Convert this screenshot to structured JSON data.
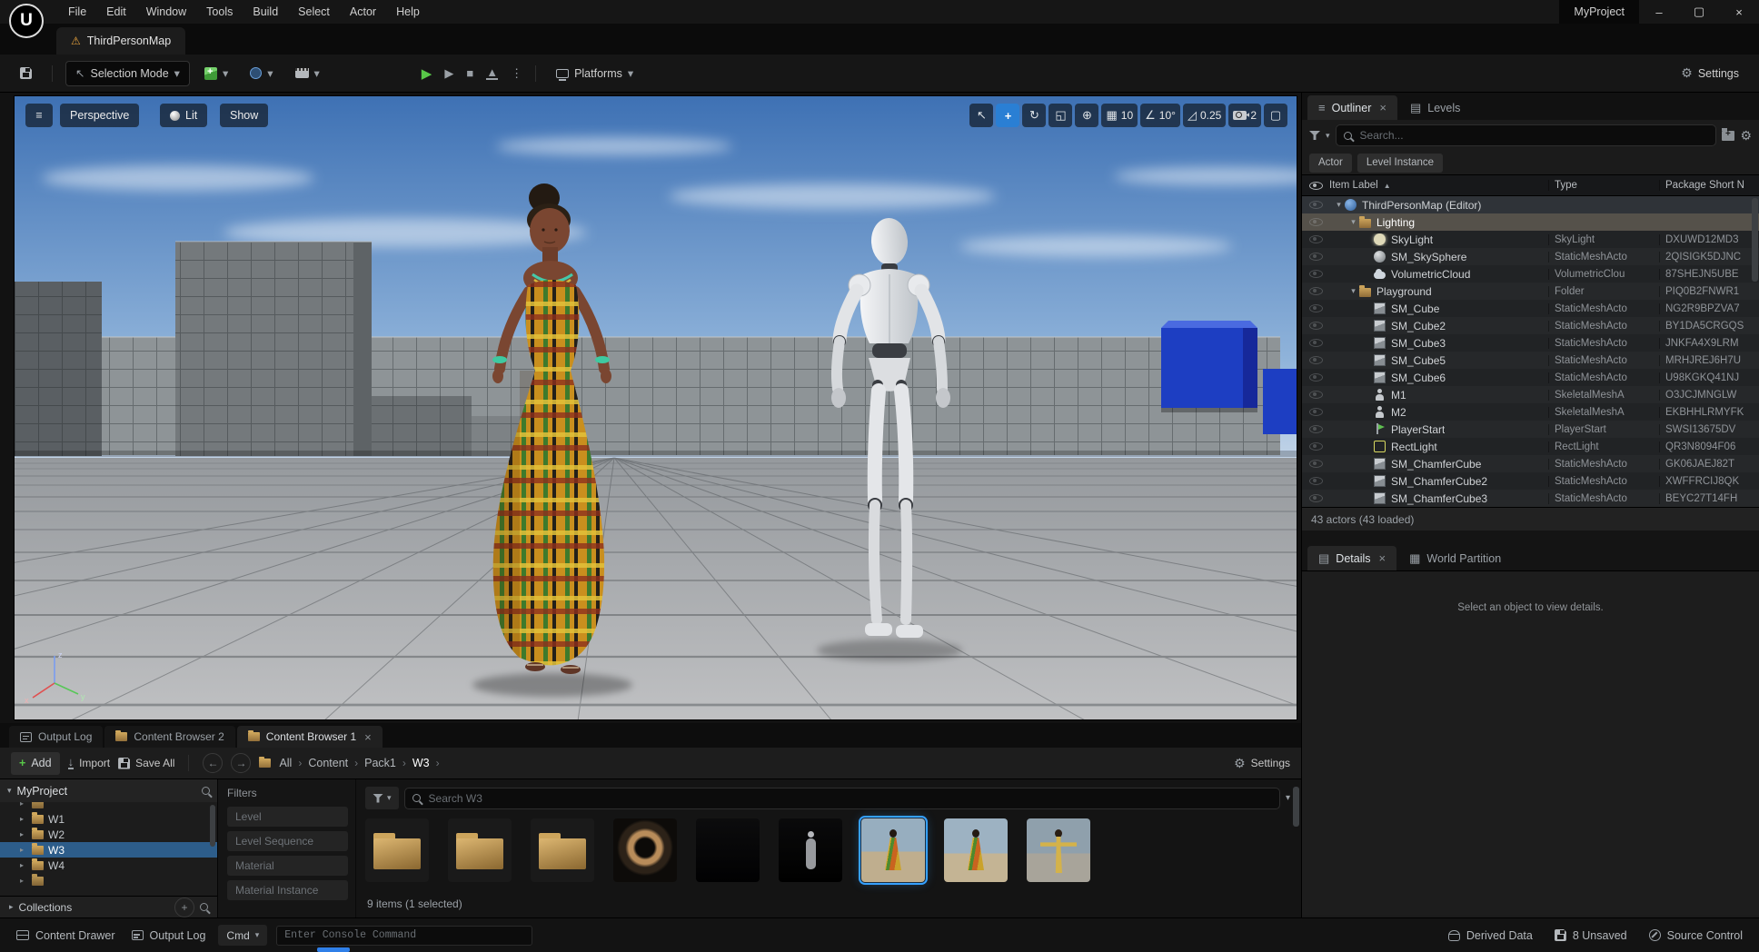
{
  "icons": {
    "logo": "U",
    "warning": "⚠",
    "menu": "≡",
    "dropdown": "▾",
    "kebab": "⋮",
    "play": "▶",
    "frame_skip": "▶",
    "stop": "■",
    "eject": "▲",
    "chevron": "›",
    "back": "←",
    "forward": "→",
    "select": "↖",
    "move": "+",
    "rotate": "↻",
    "scale": "◱",
    "globe": "⊕",
    "grid": "▦",
    "angle": "∠",
    "scale_snap": "◿",
    "maximize": "▢",
    "close": "×",
    "minimize": "–",
    "restore": "▢",
    "gear": "⚙",
    "layers": "▤",
    "world_grid": "▦",
    "doc": "▤",
    "plus": "+",
    "sort_asc": "▲",
    "expand": "▾",
    "collapse": "▸"
  },
  "menubar": {
    "items": [
      "File",
      "Edit",
      "Window",
      "Tools",
      "Build",
      "Select",
      "Actor",
      "Help"
    ],
    "project": "MyProject"
  },
  "asset_tab": {
    "label": "ThirdPersonMap"
  },
  "toolbar": {
    "selection_mode": "Selection Mode",
    "platforms": "Platforms",
    "settings": "Settings"
  },
  "viewport": {
    "perspective": "Perspective",
    "lit": "Lit",
    "show": "Show",
    "grid_snap": "10",
    "angle_snap": "10°",
    "scale_snap": "0.25",
    "camera_speed": "2",
    "axis": {
      "x": "x",
      "y": "y",
      "z": "z"
    }
  },
  "outliner": {
    "tab": "Outliner",
    "levels_tab": "Levels",
    "search_placeholder": "Search...",
    "actor_button": "Actor",
    "level_instance_button": "Level Instance",
    "columns": {
      "item": "Item Label",
      "type": "Type",
      "package": "Package Short N"
    },
    "rows": [
      {
        "label": "ThirdPersonMap (Editor)",
        "type": "",
        "package": "",
        "icon": "world",
        "indent": 0,
        "expand": true,
        "state": "soft"
      },
      {
        "label": "Lighting",
        "type": "",
        "package": "",
        "icon": "folder",
        "indent": 1,
        "expand": true,
        "state": "sel"
      },
      {
        "label": "SkyLight",
        "type": "SkyLight",
        "package": "DXUWD12MD3",
        "icon": "skylight",
        "indent": 2
      },
      {
        "label": "SM_SkySphere",
        "type": "StaticMeshActo",
        "package": "2QISIGK5DJNC",
        "icon": "sphere",
        "indent": 2
      },
      {
        "label": "VolumetricCloud",
        "type": "VolumetricClou",
        "package": "87SHEJN5UBE",
        "icon": "cloud",
        "indent": 2
      },
      {
        "label": "Playground",
        "type": "Folder",
        "package": "PIQ0B2FNWR1",
        "icon": "folder",
        "indent": 1,
        "expand": true
      },
      {
        "label": "SM_Cube",
        "type": "StaticMeshActo",
        "package": "NG2R9BPZVA7",
        "icon": "cube",
        "indent": 2
      },
      {
        "label": "SM_Cube2",
        "type": "StaticMeshActo",
        "package": "BY1DA5CRGQS",
        "icon": "cube",
        "indent": 2
      },
      {
        "label": "SM_Cube3",
        "type": "StaticMeshActo",
        "package": "JNKFA4X9LRM",
        "icon": "cube",
        "indent": 2
      },
      {
        "label": "SM_Cube5",
        "type": "StaticMeshActo",
        "package": "MRHJREJ6H7U",
        "icon": "cube",
        "indent": 2
      },
      {
        "label": "SM_Cube6",
        "type": "StaticMeshActo",
        "package": "U98KGKQ41NJ",
        "icon": "cube",
        "indent": 2
      },
      {
        "label": "M1",
        "type": "SkeletalMeshA",
        "package": "O3JCJMNGLW",
        "icon": "person",
        "indent": 2
      },
      {
        "label": "M2",
        "type": "SkeletalMeshA",
        "package": "EKBHHLRMYFK",
        "icon": "person",
        "indent": 2
      },
      {
        "label": "PlayerStart",
        "type": "PlayerStart",
        "package": "SWSI13675DV",
        "icon": "playerstart",
        "indent": 2
      },
      {
        "label": "RectLight",
        "type": "RectLight",
        "package": "QR3N8094F06",
        "icon": "rectlight",
        "indent": 2
      },
      {
        "label": "SM_ChamferCube",
        "type": "StaticMeshActo",
        "package": "GK06JAEJ82T",
        "icon": "cube",
        "indent": 2
      },
      {
        "label": "SM_ChamferCube2",
        "type": "StaticMeshActo",
        "package": "XWFFRCIJ8QK",
        "icon": "cube",
        "indent": 2
      },
      {
        "label": "SM_ChamferCube3",
        "type": "StaticMeshActo",
        "package": "BEYC27T14FH",
        "icon": "cube",
        "indent": 2
      }
    ],
    "status": "43 actors (43 loaded)"
  },
  "details": {
    "tab": "Details",
    "world_partition_tab": "World Partition",
    "empty": "Select an object to view details."
  },
  "bottom_tabs": [
    {
      "label": "Output Log"
    },
    {
      "label": "Content Browser 2"
    },
    {
      "label": "Content Browser 1",
      "active": true
    }
  ],
  "content_browser": {
    "add": "Add",
    "import": "Import",
    "save_all": "Save All",
    "path": [
      "All",
      "Content",
      "Pack1",
      "W3"
    ],
    "settings": "Settings",
    "sources_title": "MyProject",
    "tree": [
      {
        "label": "",
        "partial": true
      },
      {
        "label": "W1"
      },
      {
        "label": "W2"
      },
      {
        "label": "W3",
        "selected": true
      },
      {
        "label": "W4"
      },
      {
        "label": "",
        "partial": true
      }
    ],
    "collections": "Collections",
    "filters_title": "Filters",
    "filters": [
      "Level",
      "Level Sequence",
      "Material",
      "Material Instance"
    ],
    "search_placeholder": "Search W3",
    "items": [
      {
        "kind": "folder"
      },
      {
        "kind": "folder"
      },
      {
        "kind": "folder"
      },
      {
        "kind": "material"
      },
      {
        "kind": "dark"
      },
      {
        "kind": "dark-figure"
      },
      {
        "kind": "char-a",
        "selected": true
      },
      {
        "kind": "char-b"
      },
      {
        "kind": "char-c"
      }
    ],
    "status": "9 items (1 selected)"
  },
  "statusbar": {
    "content_drawer": "Content Drawer",
    "output_log": "Output Log",
    "cmd": "Cmd",
    "console_placeholder": "Enter Console Command",
    "derived_data": "Derived Data",
    "unsaved": "8 Unsaved",
    "source_control": "Source Control"
  }
}
